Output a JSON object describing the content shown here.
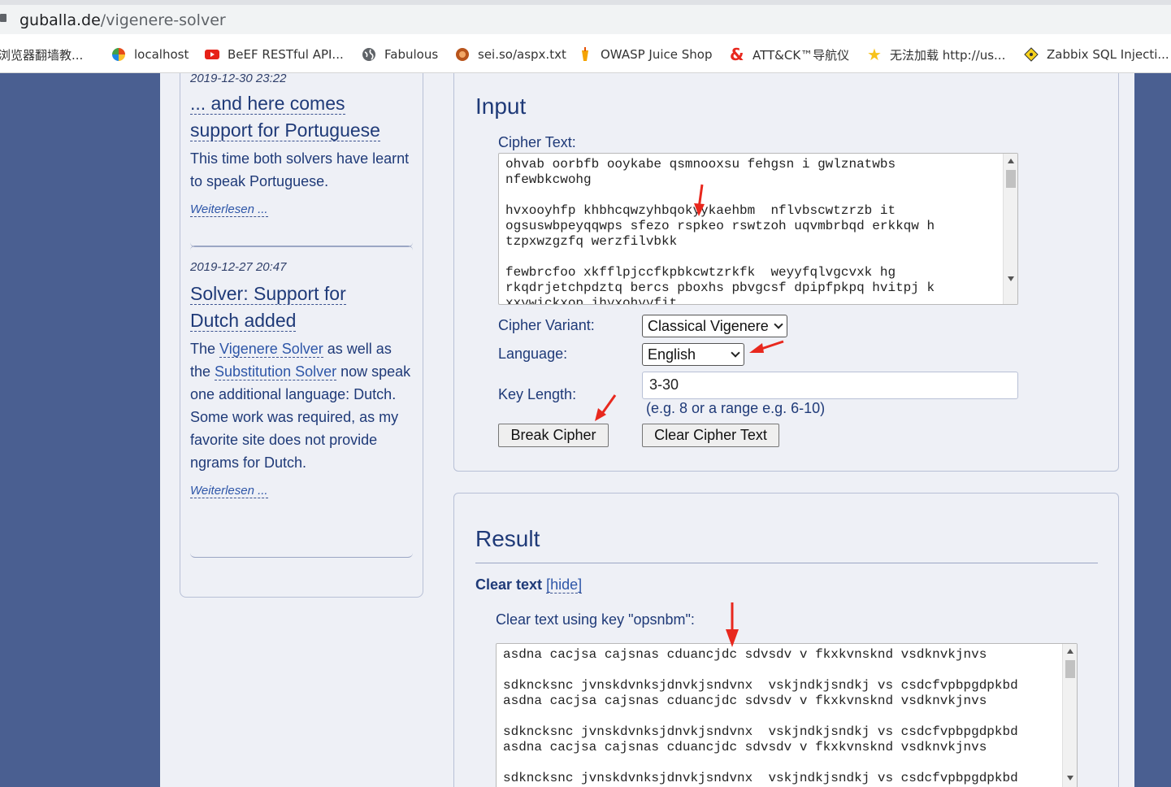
{
  "browser": {
    "url_host": "guballa.de",
    "url_path": "/vigenere-solver",
    "bookmarks": [
      {
        "label": "浏览器翻墙教...",
        "icon": "bookmark-icon"
      },
      {
        "label": "localhost",
        "icon": "pinwheel-icon"
      },
      {
        "label": "BeEF RESTful API...",
        "icon": "youtube-icon"
      },
      {
        "label": "Fabulous",
        "icon": "globe-icon"
      },
      {
        "label": "sei.so/aspx.txt",
        "icon": "orange-circle-icon"
      },
      {
        "label": "OWASP Juice Shop",
        "icon": "juice-icon"
      },
      {
        "label": "ATT&CK™导航仪",
        "icon": "ampersand-icon"
      },
      {
        "label": "无法加载 http://us...",
        "icon": "star-icon"
      },
      {
        "label": "Zabbix SQL Injecti...",
        "icon": "diamond-icon"
      }
    ]
  },
  "sidebar": {
    "posts": [
      {
        "date": "2019-12-30 23:22",
        "title_lines": [
          "... and here comes",
          "support for Portuguese"
        ],
        "body": "This time both solvers have learnt to speak Portuguese.",
        "more": "Weiterlesen ..."
      },
      {
        "date": "2019-12-27 20:47",
        "title_lines": [
          "Solver: Support for",
          "Dutch added"
        ],
        "body_parts": {
          "p1": "The ",
          "link1": "Vigenere Solver",
          "p2": " as well as the ",
          "link2": "Substitution Solver",
          "p3": " now speak one additional language: Dutch. Some work was required, as my favorite site does not provide ngrams for Dutch."
        },
        "more": "Weiterlesen ..."
      }
    ]
  },
  "input_panel": {
    "heading": "Input",
    "cipher_label": "Cipher Text:",
    "cipher_text": "ohvab oorbfb ooykabe qsmnooxsu fehgsn i gwlznatwbs\nnfewbkcwohg\n\nhvxooyhfp khbhcqwzyhbqokyykaehbm  nflvbscwtzrzb it\nogsuswbpeyqqwps sfezo rspkeo rswtzoh uqvmbrbqd erkkqw h\ntzpxwzgzfq werzfilvbkk\n\nfewbrcfoo xkfflpjccfkpbkcwtzrkfk  weyyfqlvgcvxk hg\nrkqdrjetchpdztq bercs pboxhs pbvgcsf dpipfpkpq hvitpj k\nxxywickxop ihyxohyyfit",
    "variant_label": "Cipher Variant:",
    "variant_value": "Classical Vigenere",
    "language_label": "Language:",
    "language_value": "English",
    "keylength_label": "Key Length:",
    "keylength_value": "3-30",
    "keylength_hint": "(e.g. 8 or a range e.g. 6-10)",
    "break_button": "Break Cipher",
    "clear_button": "Clear Cipher Text"
  },
  "result_panel": {
    "heading": "Result",
    "cleartext_label": "Clear text",
    "hide_link": "[hide]",
    "key_caption": "Clear text using key \"opsnbm\":",
    "clear_text": "asdna cacjsa cajsnas cduancjdc sdvsdv v fkxkvnsknd vsdknvkjnvs\n\nsdkncksnc jvnskdvnksjdnvkjsndvnx  vskjndkjsndkj vs csdcfvpbpgdpkbd\nasdna cacjsa cajsnas cduancjdc sdvsdv v fkxkvnsknd vsdknvkjnvs\n\nsdkncksnc jvnskdvnksjdnvkjsndvnx  vskjndkjsndkj vs csdcfvpbpgdpkbd\nasdna cacjsa cajsnas cduancjdc sdvsdv v fkxkvnsknd vsdknvkjnvs\n\nsdkncksnc jvnskdvnksjdnvkjsndvnx  vskjndkjsndkj vs csdcfvpbpgdpkbd"
  },
  "colors": {
    "page_bg": "#4a5f91",
    "content_bg": "#eef0f6",
    "heading": "#1f3a78",
    "annotation_arrow": "#e8281e"
  }
}
